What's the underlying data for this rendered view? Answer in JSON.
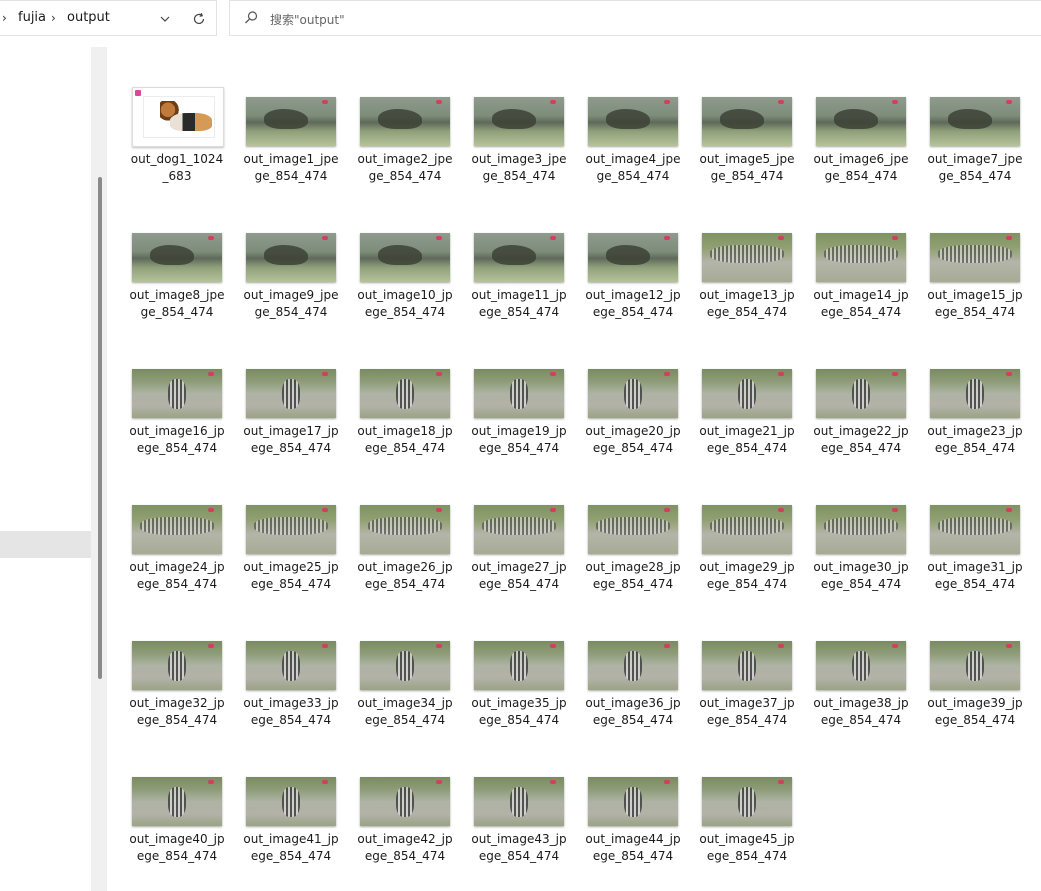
{
  "breadcrumb": {
    "items": [
      "fujia",
      "output"
    ]
  },
  "search": {
    "placeholder": "搜索\"output\""
  },
  "files": [
    {
      "line1": "out_dog1_1024",
      "line2": "_683",
      "kind": "photo"
    },
    {
      "line1": "out_image1_jpe",
      "line2": "ge_854_474",
      "kind": "dog"
    },
    {
      "line1": "out_image2_jpe",
      "line2": "ge_854_474",
      "kind": "dog"
    },
    {
      "line1": "out_image3_jpe",
      "line2": "ge_854_474",
      "kind": "dog"
    },
    {
      "line1": "out_image4_jpe",
      "line2": "ge_854_474",
      "kind": "dog"
    },
    {
      "line1": "out_image5_jpe",
      "line2": "ge_854_474",
      "kind": "dog"
    },
    {
      "line1": "out_image6_jpe",
      "line2": "ge_854_474",
      "kind": "dog"
    },
    {
      "line1": "out_image7_jpe",
      "line2": "ge_854_474",
      "kind": "dog"
    },
    {
      "line1": "out_image8_jpe",
      "line2": "ge_854_474",
      "kind": "dog"
    },
    {
      "line1": "out_image9_jpe",
      "line2": "ge_854_474",
      "kind": "dog"
    },
    {
      "line1": "out_image10_jp",
      "line2": "ege_854_474",
      "kind": "dog"
    },
    {
      "line1": "out_image11_jp",
      "line2": "ege_854_474",
      "kind": "dog"
    },
    {
      "line1": "out_image12_jp",
      "line2": "ege_854_474",
      "kind": "dog"
    },
    {
      "line1": "out_image13_jp",
      "line2": "ege_854_474",
      "kind": "herd"
    },
    {
      "line1": "out_image14_jp",
      "line2": "ege_854_474",
      "kind": "herd"
    },
    {
      "line1": "out_image15_jp",
      "line2": "ege_854_474",
      "kind": "herd"
    },
    {
      "line1": "out_image16_jp",
      "line2": "ege_854_474",
      "kind": "zebra"
    },
    {
      "line1": "out_image17_jp",
      "line2": "ege_854_474",
      "kind": "zebra"
    },
    {
      "line1": "out_image18_jp",
      "line2": "ege_854_474",
      "kind": "zebra"
    },
    {
      "line1": "out_image19_jp",
      "line2": "ege_854_474",
      "kind": "zebra"
    },
    {
      "line1": "out_image20_jp",
      "line2": "ege_854_474",
      "kind": "zebra"
    },
    {
      "line1": "out_image21_jp",
      "line2": "ege_854_474",
      "kind": "zebra"
    },
    {
      "line1": "out_image22_jp",
      "line2": "ege_854_474",
      "kind": "zebra"
    },
    {
      "line1": "out_image23_jp",
      "line2": "ege_854_474",
      "kind": "zebra"
    },
    {
      "line1": "out_image24_jp",
      "line2": "ege_854_474",
      "kind": "herd"
    },
    {
      "line1": "out_image25_jp",
      "line2": "ege_854_474",
      "kind": "herd"
    },
    {
      "line1": "out_image26_jp",
      "line2": "ege_854_474",
      "kind": "herd"
    },
    {
      "line1": "out_image27_jp",
      "line2": "ege_854_474",
      "kind": "herd"
    },
    {
      "line1": "out_image28_jp",
      "line2": "ege_854_474",
      "kind": "herd"
    },
    {
      "line1": "out_image29_jp",
      "line2": "ege_854_474",
      "kind": "herd"
    },
    {
      "line1": "out_image30_jp",
      "line2": "ege_854_474",
      "kind": "herd"
    },
    {
      "line1": "out_image31_jp",
      "line2": "ege_854_474",
      "kind": "herd"
    },
    {
      "line1": "out_image32_jp",
      "line2": "ege_854_474",
      "kind": "zebra"
    },
    {
      "line1": "out_image33_jp",
      "line2": "ege_854_474",
      "kind": "zebra"
    },
    {
      "line1": "out_image34_jp",
      "line2": "ege_854_474",
      "kind": "zebra"
    },
    {
      "line1": "out_image35_jp",
      "line2": "ege_854_474",
      "kind": "zebra"
    },
    {
      "line1": "out_image36_jp",
      "line2": "ege_854_474",
      "kind": "zebra"
    },
    {
      "line1": "out_image37_jp",
      "line2": "ege_854_474",
      "kind": "zebra"
    },
    {
      "line1": "out_image38_jp",
      "line2": "ege_854_474",
      "kind": "zebra"
    },
    {
      "line1": "out_image39_jp",
      "line2": "ege_854_474",
      "kind": "zebra"
    },
    {
      "line1": "out_image40_jp",
      "line2": "ege_854_474",
      "kind": "zebra"
    },
    {
      "line1": "out_image41_jp",
      "line2": "ege_854_474",
      "kind": "zebra"
    },
    {
      "line1": "out_image42_jp",
      "line2": "ege_854_474",
      "kind": "zebra"
    },
    {
      "line1": "out_image43_jp",
      "line2": "ege_854_474",
      "kind": "zebra"
    },
    {
      "line1": "out_image44_jp",
      "line2": "ege_854_474",
      "kind": "zebra"
    },
    {
      "line1": "out_image45_jp",
      "line2": "ege_854_474",
      "kind": "zebra"
    }
  ],
  "icons": {
    "back_chevron": "chevron-right-icon",
    "dropdown": "chevron-down-icon",
    "refresh": "refresh-icon",
    "search": "search-icon"
  }
}
